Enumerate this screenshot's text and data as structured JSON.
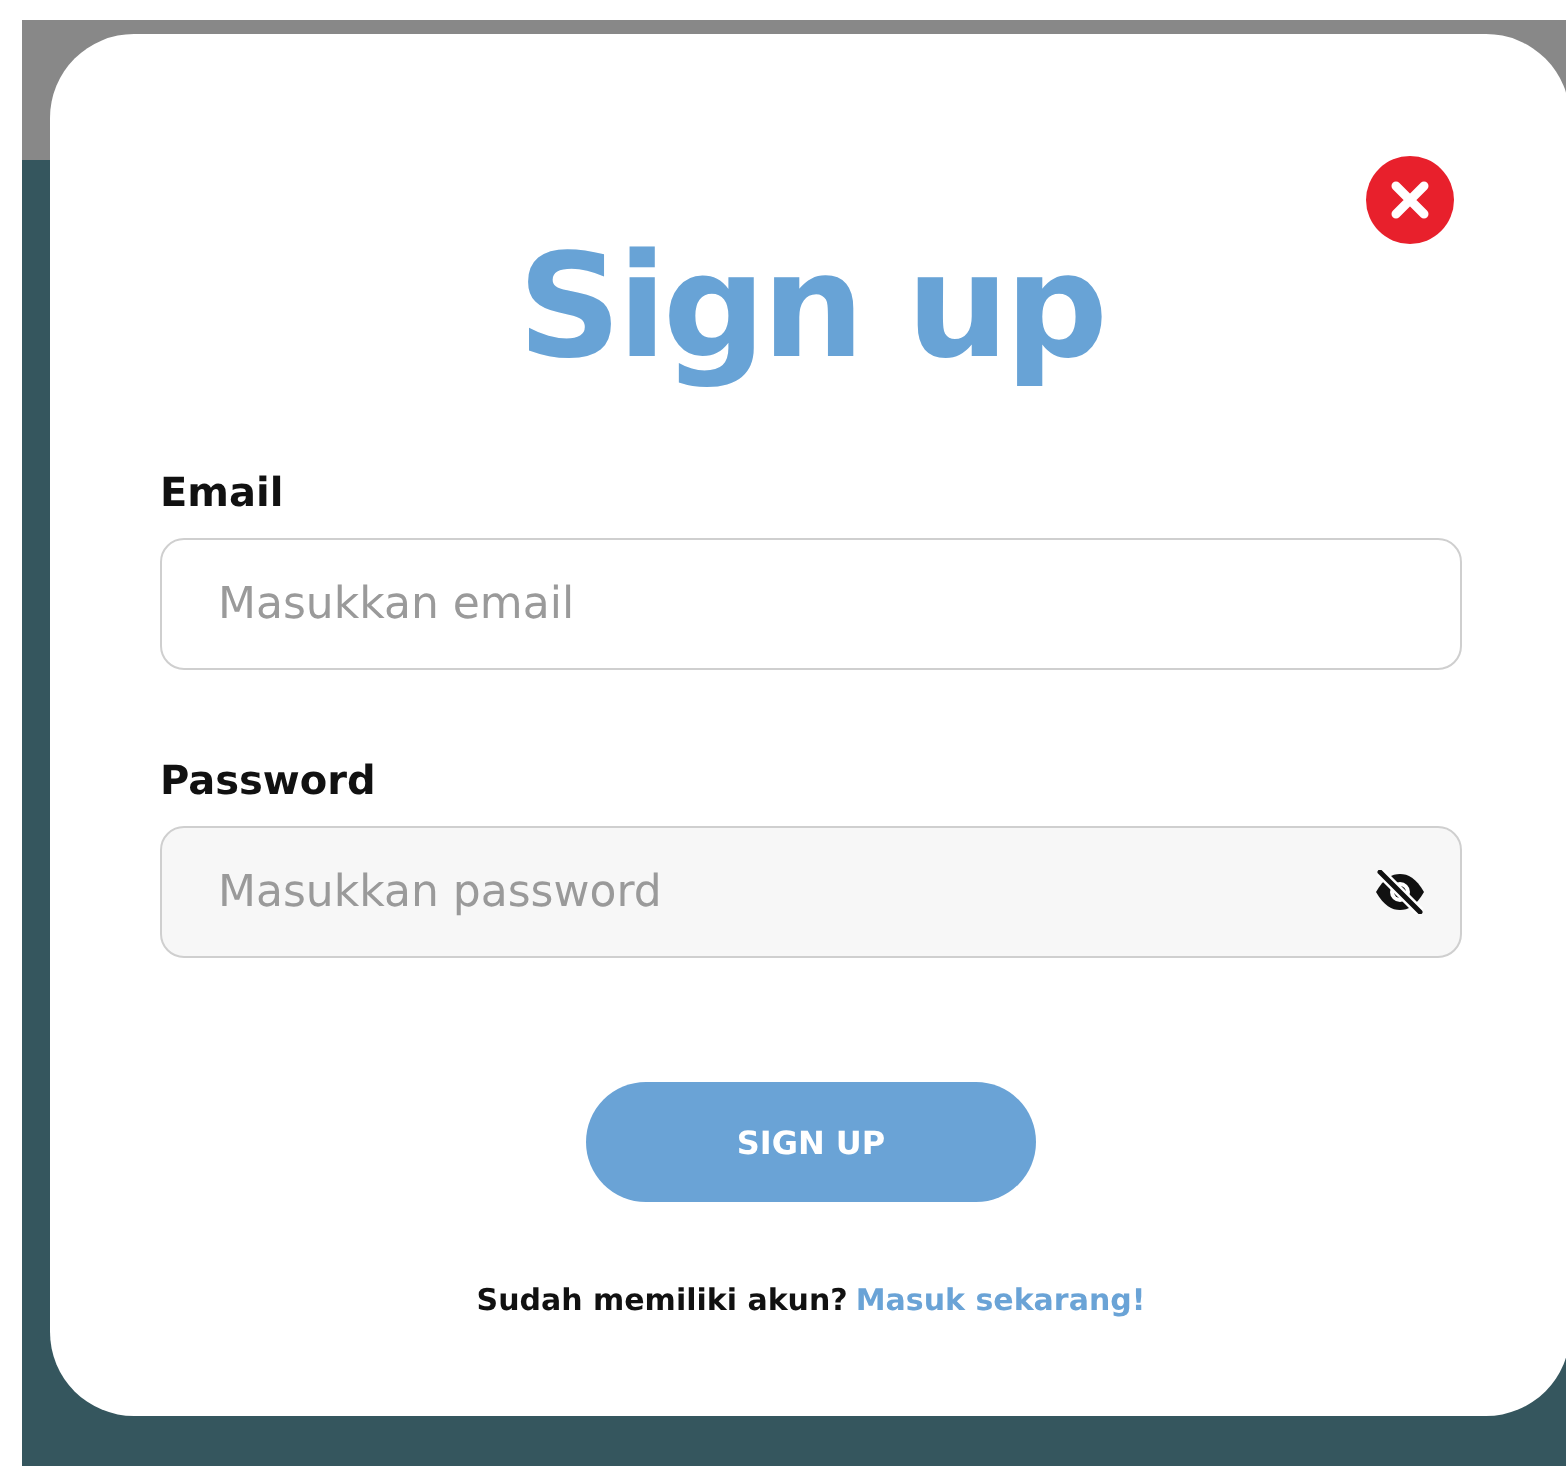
{
  "dialog": {
    "title": "Sign up",
    "fields": [
      {
        "label": "Email",
        "placeholder": "Masukkan email",
        "kind": "text"
      },
      {
        "label": "Password",
        "placeholder": "Masukkan password",
        "kind": "password"
      }
    ],
    "submit": "SIGN UP",
    "footer": {
      "text": "Sudah memiliki akun?",
      "link": "Masuk sekarang!"
    }
  }
}
